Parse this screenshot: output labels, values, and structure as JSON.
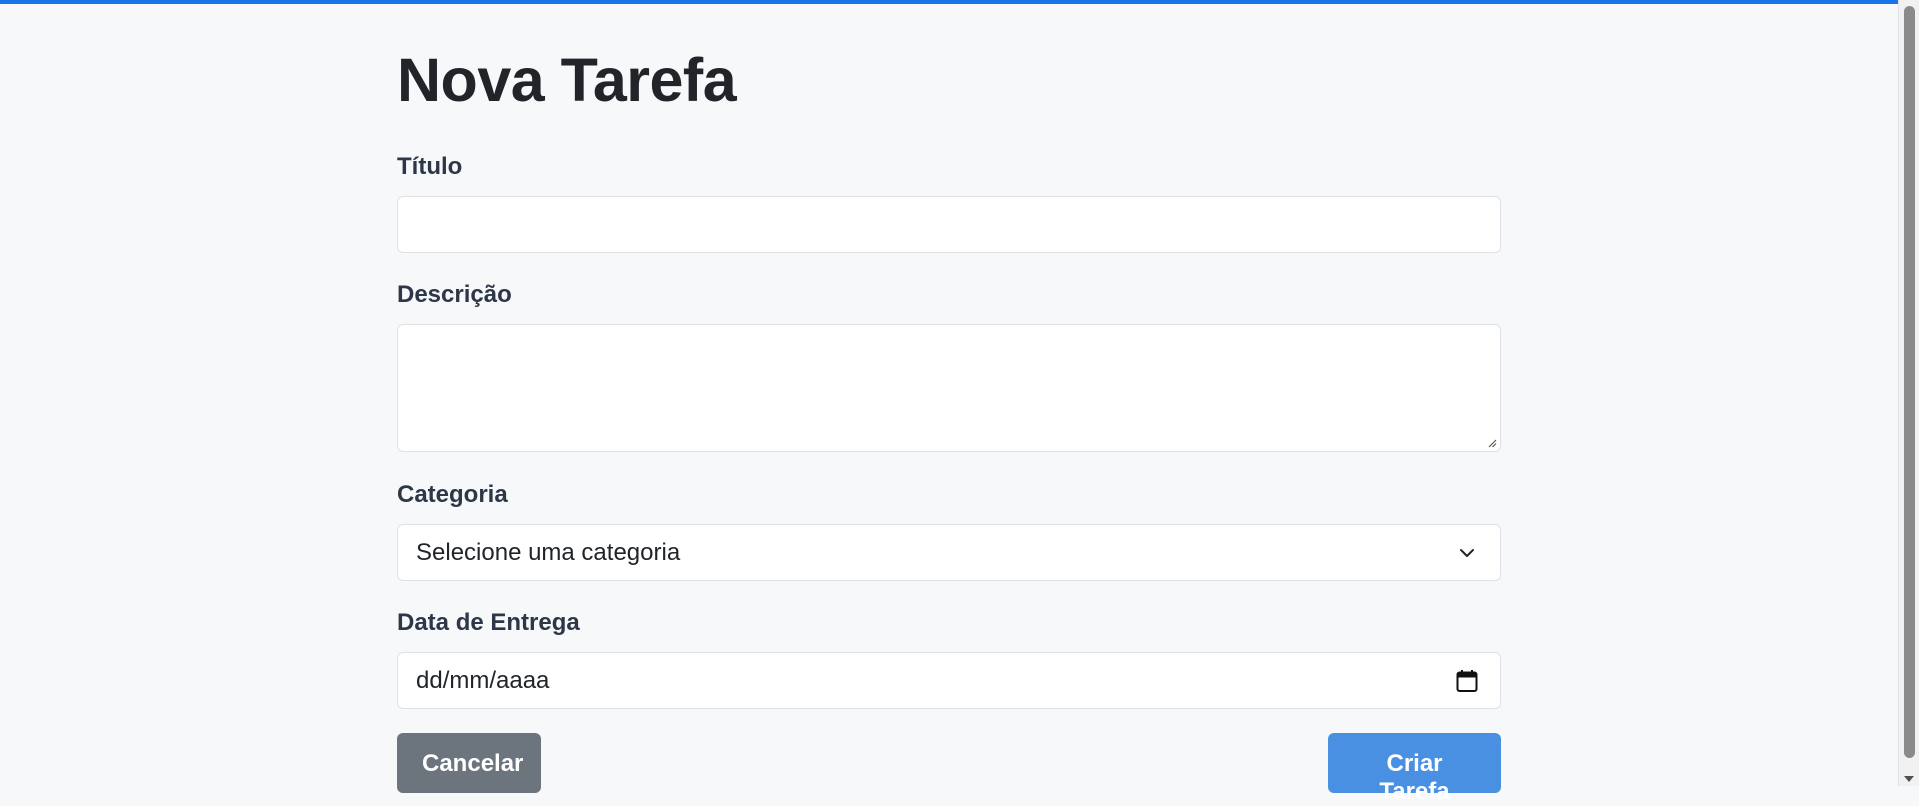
{
  "page": {
    "title": "Nova Tarefa"
  },
  "form": {
    "title_label": "Título",
    "title_value": "",
    "description_label": "Descrição",
    "description_value": "",
    "category_label": "Categoria",
    "category_selected": "Selecione uma categoria",
    "due_date_label": "Data de Entrega",
    "due_date_placeholder": "dd/mm/aaaa"
  },
  "actions": {
    "cancel_label": "Cancelar",
    "submit_label": "Criar Tarefa"
  },
  "colors": {
    "accent_bar": "#1a73e8",
    "primary_button": "#4a90e2",
    "secondary_button": "#6c757d",
    "background": "#f7f8fa"
  },
  "icons": {
    "select": "chevron-down-icon",
    "date": "calendar-icon",
    "textarea": "resize-handle-icon"
  }
}
